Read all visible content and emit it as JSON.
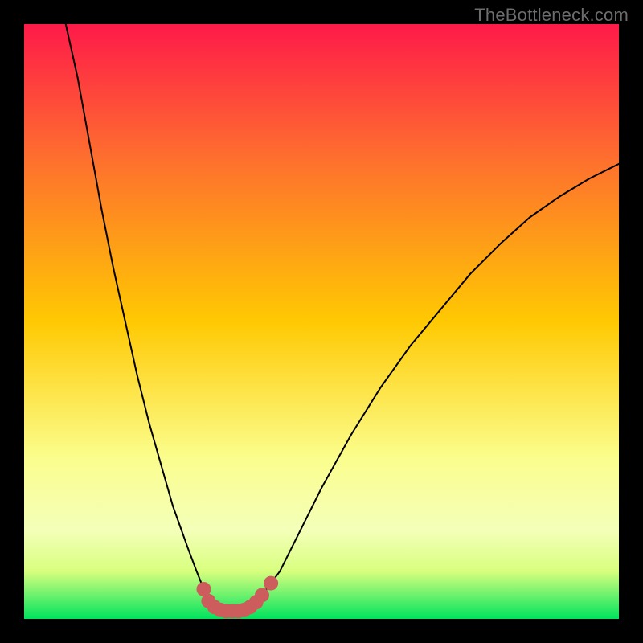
{
  "watermark": {
    "text": "TheBottleneck.com"
  },
  "colors": {
    "frame_bg": "#000000",
    "curve": "#000000",
    "marker": "#cd5c5c",
    "gradient_top": "#fe1a49",
    "gradient_mid1": "#ffc902",
    "gradient_mid2": "#fbfe8d",
    "gradient_band": "#d8ff7e",
    "gradient_bottom": "#00e35d"
  },
  "plot": {
    "gradient_css": "linear-gradient(to bottom, #fe1a49 0%, #fe6d2f 22%, #ffc902 50%, #fbfe8d 73%, #f4ffb9 85%, #d8ff7e 92%, #00e35d 100%)"
  },
  "chart_data": {
    "type": "line",
    "title": "",
    "xlabel": "",
    "ylabel": "",
    "xlim": [
      0,
      100
    ],
    "ylim": [
      0,
      100
    ],
    "note": "Axes are unlabeled in the source image; x/y are expressed as percentages of the plot area width/height. y=100 is the top of the colored area.",
    "series": [
      {
        "name": "left-branch",
        "x": [
          7.0,
          9.0,
          11.0,
          13.0,
          15.0,
          17.0,
          19.0,
          21.0,
          23.0,
          25.0,
          27.5,
          29.0,
          30.2,
          31.0
        ],
        "y": [
          100.0,
          91.0,
          80.0,
          69.0,
          59.0,
          50.0,
          41.0,
          33.0,
          26.0,
          19.0,
          12.0,
          8.0,
          5.0,
          3.0
        ]
      },
      {
        "name": "valley",
        "x": [
          31.0,
          32.0,
          33.0,
          34.0,
          35.0,
          36.0,
          37.0,
          38.0,
          39.0,
          40.0
        ],
        "y": [
          3.0,
          2.0,
          1.5,
          1.3,
          1.3,
          1.3,
          1.5,
          2.0,
          2.8,
          4.0
        ]
      },
      {
        "name": "right-branch",
        "x": [
          40.0,
          43.0,
          46.0,
          50.0,
          55.0,
          60.0,
          65.0,
          70.0,
          75.0,
          80.0,
          85.0,
          90.0,
          95.0,
          100.0
        ],
        "y": [
          4.0,
          8.0,
          14.0,
          22.0,
          31.0,
          39.0,
          46.0,
          52.0,
          58.0,
          63.0,
          67.5,
          71.0,
          74.0,
          76.5
        ]
      }
    ],
    "markers": {
      "name": "highlighted-bottleneck-range",
      "color": "#cd5c5c",
      "x": [
        30.2,
        31.0,
        32.0,
        33.0,
        34.0,
        35.0,
        36.0,
        37.0,
        38.0,
        39.0,
        40.0,
        41.5
      ],
      "y": [
        5.0,
        3.0,
        2.0,
        1.5,
        1.3,
        1.3,
        1.3,
        1.5,
        2.0,
        2.8,
        4.0,
        6.0
      ]
    }
  }
}
